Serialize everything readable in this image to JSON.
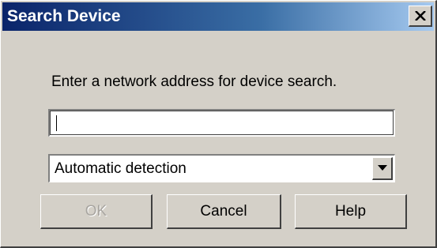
{
  "window": {
    "title": "Search Device",
    "close_icon": "close-x-icon"
  },
  "prompt_text": "Enter a network address for device search.",
  "address_field": {
    "value": "",
    "placeholder": ""
  },
  "detection_select": {
    "selected": "Automatic detection",
    "arrow_icon": "chevron-down-icon"
  },
  "buttons": {
    "ok_label": "OK",
    "ok_enabled": false,
    "cancel_label": "Cancel",
    "help_label": "Help"
  },
  "colors": {
    "titlebar_start": "#0a246a",
    "titlebar_end": "#a6caf0",
    "face": "#d4d0c8"
  }
}
